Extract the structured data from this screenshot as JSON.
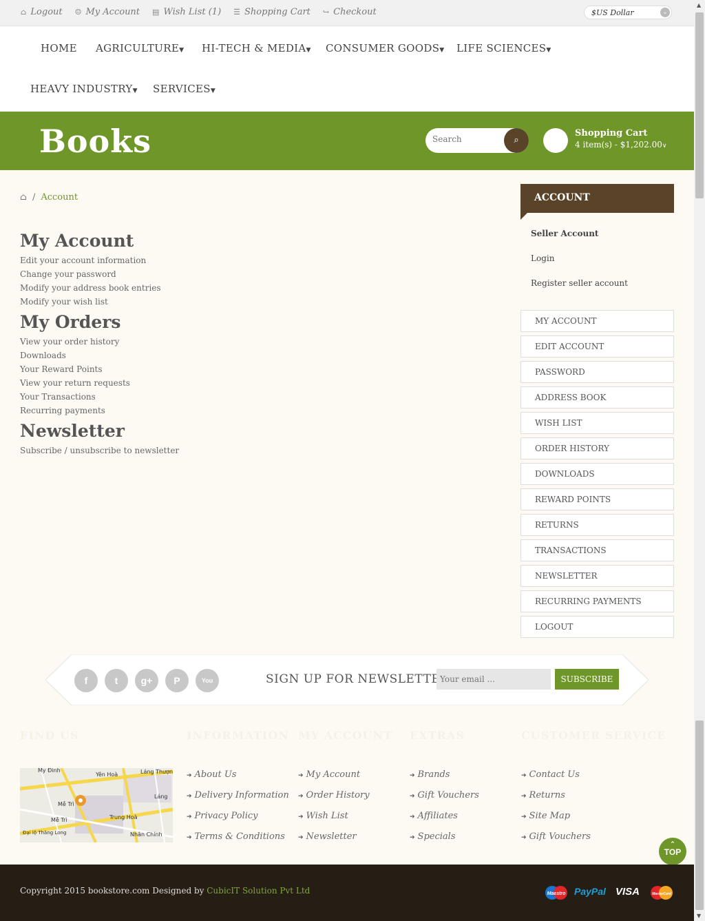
{
  "topbar": {
    "links": [
      {
        "icon": "lock-icon",
        "glyph": "🔒",
        "label": "Logout"
      },
      {
        "icon": "user-icon",
        "glyph": "👤",
        "label": "My Account"
      },
      {
        "icon": "list-icon",
        "glyph": "▤",
        "label": "Wish List (1)"
      },
      {
        "icon": "cart-icon",
        "glyph": "🛒",
        "label": "Shopping Cart"
      },
      {
        "icon": "share-icon",
        "glyph": "↪",
        "label": "Checkout"
      }
    ],
    "currency": "$US Dollar"
  },
  "nav": {
    "items": [
      "HOME",
      "AGRICULTURE",
      "HI-TECH & MEDIA",
      "CONSUMER GOODS",
      "LIFE SCIENCES",
      "HEAVY INDUSTRY",
      "SERVICES"
    ]
  },
  "header": {
    "logo": "Books",
    "search_placeholder": "Search",
    "cart_title": "Shopping Cart",
    "cart_summary": "4 item(s) - $1,202.00"
  },
  "breadcrumb": {
    "current": "Account"
  },
  "main": {
    "sections": [
      {
        "title": "My Account",
        "links": [
          "Edit your account information",
          "Change your password",
          "Modify your address book entries",
          "Modify your wish list"
        ]
      },
      {
        "title": "My Orders",
        "links": [
          "View your order history",
          "Downloads",
          "Your Reward Points",
          "View your return requests",
          "Your Transactions",
          "Recurring payments"
        ]
      },
      {
        "title": "Newsletter",
        "links": [
          "Subscribe / unsubscribe to newsletter"
        ]
      }
    ]
  },
  "sidebar": {
    "title": "ACCOUNT",
    "seller_links": [
      "Seller Account",
      "Login",
      "Register seller account"
    ],
    "menu": [
      "MY ACCOUNT",
      "EDIT ACCOUNT",
      "PASSWORD",
      "ADDRESS BOOK",
      "WISH LIST",
      "ORDER HISTORY",
      "DOWNLOADS",
      "REWARD POINTS",
      "RETURNS",
      "TRANSACTIONS",
      "NEWSLETTER",
      "RECURRING PAYMENTS",
      "LOGOUT"
    ]
  },
  "newsletter": {
    "social": [
      {
        "icon": "facebook-icon",
        "glyph": "f"
      },
      {
        "icon": "twitter-icon",
        "glyph": "t"
      },
      {
        "icon": "google-plus-icon",
        "glyph": "g+"
      },
      {
        "icon": "pinterest-icon",
        "glyph": "P"
      },
      {
        "icon": "youtube-icon",
        "glyph": "You"
      }
    ],
    "title": "SIGN UP FOR NEWSLETTER",
    "email_placeholder": "Your email ...",
    "button": "SUBSCRIBE"
  },
  "footer": {
    "headings": [
      "FIND US",
      "INFORMATION",
      "MY ACCOUNT",
      "EXTRAS",
      "CUSTOMER SERVICE"
    ],
    "map_labels": [
      "My Đình",
      "Yên Hoà",
      "Láng Thượng",
      "Láng",
      "Mễ Trì",
      "Mễ Trì",
      "Trung Hoà",
      "Nhân Chính",
      "Đại lộ Thăng Long"
    ],
    "columns": [
      [
        "About Us",
        "Delivery Information",
        "Privacy Policy",
        "Terms & Conditions"
      ],
      [
        "My Account",
        "Order History",
        "Wish List",
        "Newsletter"
      ],
      [
        "Brands",
        "Gift Vouchers",
        "Affiliates",
        "Specials"
      ],
      [
        "Contact Us",
        "Returns",
        "Site Map",
        "Gift Vouchers"
      ]
    ],
    "top_button": "TOP",
    "copyright": "Copyright 2015 bookstore.com Designed by ",
    "designer": "CubicIT Solution Pvt Ltd",
    "payments": [
      "Maestro",
      "PayPal",
      "VISA",
      "MasterCard"
    ]
  },
  "colors": {
    "accent": "#6e9628",
    "brown": "#5a4429",
    "footer_bg": "#261e15",
    "page_bg": "#fdfaf4"
  }
}
